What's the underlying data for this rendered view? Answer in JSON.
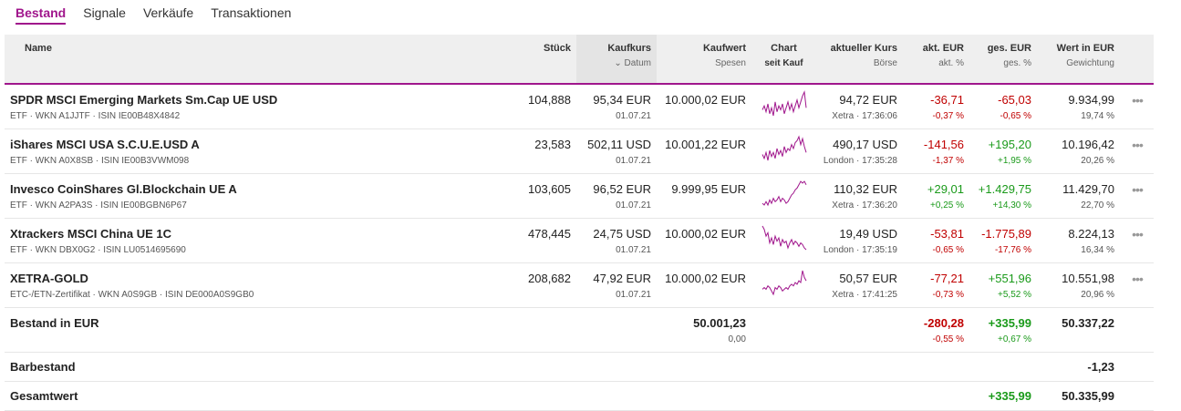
{
  "tabs": [
    "Bestand",
    "Signale",
    "Verkäufe",
    "Transaktionen"
  ],
  "header": {
    "name": "Name",
    "stueck": "Stück",
    "kaufkurs": "Kaufkurs",
    "datum": "Datum",
    "kaufwert": "Kaufwert",
    "spesen": "Spesen",
    "chart": "Chart",
    "seit_kauf": "seit Kauf",
    "kurs": "aktueller Kurs",
    "boerse": "Börse",
    "akt_eur": "akt. EUR",
    "akt_pct": "akt. %",
    "ges_eur": "ges. EUR",
    "ges_pct": "ges. %",
    "wert": "Wert in EUR",
    "gewichtung": "Gewichtung"
  },
  "colors": {
    "accent": "#a0168c",
    "negative": "#c00000",
    "positive": "#1a9a1a"
  },
  "rows": [
    {
      "name": "SPDR MSCI Emerging Markets Sm.Cap UE USD",
      "meta": "ETF · WKN A1JJTF · ISIN IE00B48X4842",
      "stueck": "104,888",
      "kaufkurs": "95,34 EUR",
      "datum": "01.07.21",
      "kaufwert": "10.000,02 EUR",
      "kurs": "94,72 EUR",
      "boerse": "Xetra · 17:36:06",
      "akt_eur": "-36,71",
      "akt_pct": "-0,37 %",
      "ges_eur": "-65,03",
      "ges_pct": "-0,65 %",
      "wert": "9.934,99",
      "gewichtung": "19,74 %",
      "akt_dir": "neg",
      "ges_dir": "neg",
      "spark": [
        5,
        7,
        4,
        8,
        3,
        6,
        2,
        9,
        4,
        7,
        5,
        8,
        3,
        6,
        9,
        5,
        8,
        4,
        7,
        10,
        6,
        9,
        12,
        14,
        6
      ]
    },
    {
      "name": "iShares MSCI USA S.C.U.E.USD A",
      "meta": "ETF · WKN A0X8SB · ISIN IE00B3VWM098",
      "stueck": "23,583",
      "kaufkurs": "502,11 USD",
      "datum": "01.07.21",
      "kaufwert": "10.001,22 EUR",
      "kurs": "490,17 USD",
      "boerse": "London · 17:35:28",
      "akt_eur": "-141,56",
      "akt_pct": "-1,37 %",
      "ges_eur": "+195,20",
      "ges_pct": "+1,95 %",
      "wert": "10.196,42",
      "gewichtung": "20,26 %",
      "akt_dir": "neg",
      "ges_dir": "pos",
      "spark": [
        5,
        3,
        6,
        2,
        7,
        4,
        6,
        3,
        8,
        5,
        7,
        4,
        9,
        6,
        8,
        7,
        10,
        8,
        11,
        12,
        14,
        10,
        13,
        9,
        6
      ]
    },
    {
      "name": "Invesco CoinShares Gl.Blockchain UE A",
      "meta": "ETF · WKN A2PA3S · ISIN IE00BGBN6P67",
      "stueck": "103,605",
      "kaufkurs": "96,52 EUR",
      "datum": "01.07.21",
      "kaufwert": "9.999,95 EUR",
      "kurs": "110,32 EUR",
      "boerse": "Xetra · 17:36:20",
      "akt_eur": "+29,01",
      "akt_pct": "+0,25 %",
      "ges_eur": "+1.429,75",
      "ges_pct": "+14,30 %",
      "wert": "11.429,70",
      "gewichtung": "22,70 %",
      "akt_dir": "pos",
      "ges_dir": "pos",
      "spark": [
        3,
        2,
        4,
        2,
        5,
        3,
        6,
        4,
        5,
        7,
        4,
        6,
        5,
        3,
        4,
        6,
        8,
        9,
        11,
        12,
        14,
        16,
        15,
        16,
        14
      ]
    },
    {
      "name": "Xtrackers MSCI China UE 1C",
      "meta": "ETF · WKN DBX0G2 · ISIN LU0514695690",
      "stueck": "478,445",
      "kaufkurs": "24,75 USD",
      "datum": "01.07.21",
      "kaufwert": "10.000,02 EUR",
      "kurs": "19,49 USD",
      "boerse": "London · 17:35:19",
      "akt_eur": "-53,81",
      "akt_pct": "-0,65 %",
      "ges_eur": "-1.775,89",
      "ges_pct": "-17,76 %",
      "wert": "8.224,13",
      "gewichtung": "16,34 %",
      "akt_dir": "neg",
      "ges_dir": "neg",
      "spark": [
        16,
        14,
        10,
        12,
        6,
        9,
        5,
        10,
        7,
        9,
        4,
        8,
        6,
        7,
        3,
        6,
        8,
        5,
        7,
        6,
        4,
        6,
        5,
        3,
        2
      ]
    },
    {
      "name": "XETRA-GOLD",
      "meta": "ETC-/ETN-Zertifikat · WKN A0S9GB · ISIN DE000A0S9GB0",
      "stueck": "208,682",
      "kaufkurs": "47,92 EUR",
      "datum": "01.07.21",
      "kaufwert": "10.000,02 EUR",
      "kurs": "50,57 EUR",
      "boerse": "Xetra · 17:41:25",
      "akt_eur": "-77,21",
      "akt_pct": "-0,73 %",
      "ges_eur": "+551,96",
      "ges_pct": "+5,52 %",
      "wert": "10.551,98",
      "gewichtung": "20,96 %",
      "akt_dir": "neg",
      "ges_dir": "pos",
      "spark": [
        5,
        6,
        5,
        7,
        6,
        4,
        2,
        6,
        5,
        7,
        6,
        4,
        5,
        6,
        5,
        7,
        8,
        7,
        9,
        8,
        10,
        9,
        16,
        12,
        10
      ]
    }
  ],
  "totals": {
    "label": "Bestand in EUR",
    "kaufwert": "50.001,23",
    "spesen": "0,00",
    "akt_eur": "-280,28",
    "akt_pct": "-0,55 %",
    "ges_eur": "+335,99",
    "ges_pct": "+0,67 %",
    "wert": "50.337,22"
  },
  "barbestand": {
    "label": "Barbestand",
    "wert": "-1,23"
  },
  "gesamtwert": {
    "label": "Gesamtwert",
    "ges_eur": "+335,99",
    "wert": "50.335,99"
  },
  "actions_label": "•••"
}
